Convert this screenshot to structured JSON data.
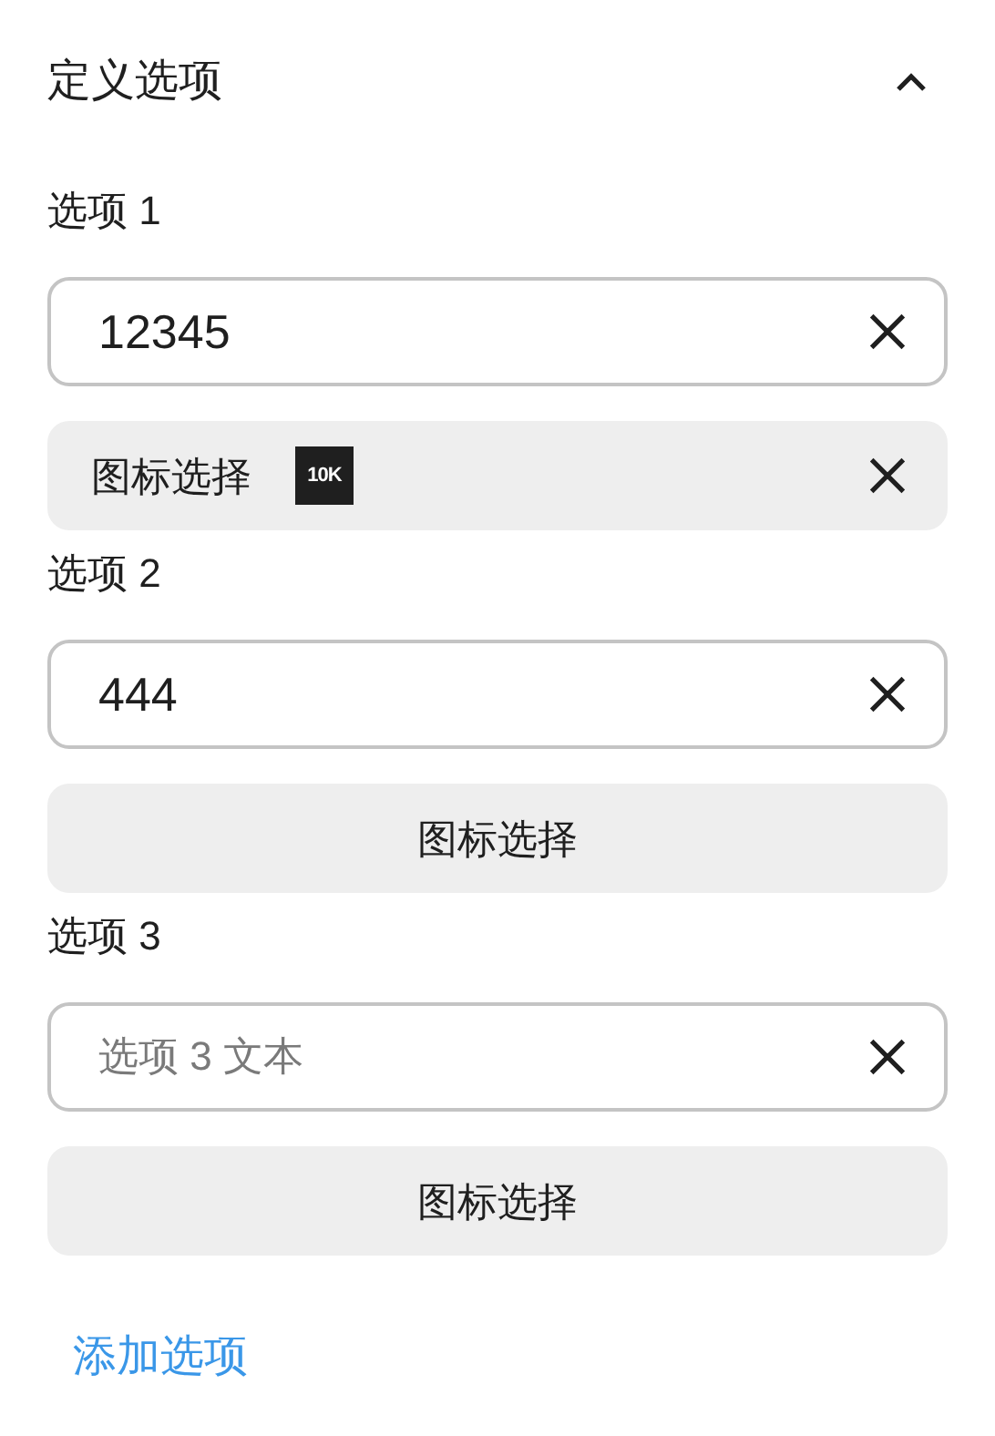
{
  "section": {
    "title": "定义选项",
    "expanded": true
  },
  "options": [
    {
      "label": "选项 1",
      "value": "12345",
      "icon_button": {
        "label": "图标选择",
        "icon_label": "10K"
      }
    },
    {
      "label": "选项 2",
      "value": "444",
      "icon_button": {
        "label": "图标选择"
      }
    },
    {
      "label": "选项 3",
      "placeholder": "选项 3 文本",
      "icon_button": {
        "label": "图标选择"
      }
    }
  ],
  "add_link": "添加选项"
}
